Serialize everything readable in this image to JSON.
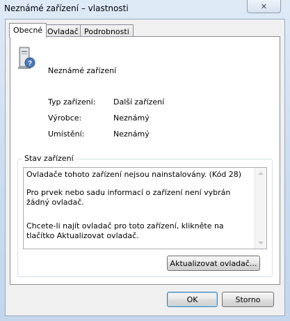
{
  "window": {
    "title": "Neznámé zařízení – vlastnosti"
  },
  "titlebar": {
    "close_glyph": "✕",
    "close_icon": "close-icon"
  },
  "tabs": [
    {
      "label": "Obecné",
      "active": true
    },
    {
      "label": "Ovladač",
      "active": false
    },
    {
      "label": "Podrobnosti",
      "active": false
    }
  ],
  "device": {
    "icon": "unknown-device-icon",
    "name": "Neznámé zařízení",
    "properties": [
      {
        "label": "Typ zařízení:",
        "value": "Další zařízení"
      },
      {
        "label": "Výrobce:",
        "value": "Neznámý"
      },
      {
        "label": "Umístění:",
        "value": "Neznámý"
      }
    ]
  },
  "status": {
    "group_label": "Stav zařízení",
    "lines": [
      "Ovladače tohoto zařízení nejsou nainstalovány. (Kód 28)",
      "Pro prvek nebo sadu informací o zařízení není vybrán žádný ovladač.",
      "Chcete-li najít ovladač pro toto zařízení, klikněte na tlačítko Aktualizovat ovladač."
    ],
    "update_button": "Aktualizovat ovladač..."
  },
  "footer": {
    "ok_button": "OK",
    "cancel_button": "Storno"
  }
}
